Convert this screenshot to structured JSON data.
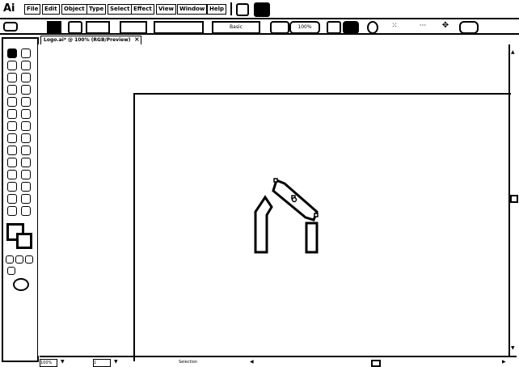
{
  "app": {
    "logo": "Ai"
  },
  "menu": [
    "File",
    "Edit",
    "Object",
    "Type",
    "Select",
    "Effect",
    "View",
    "Window",
    "Help"
  ],
  "control": {
    "opacity": "100%",
    "stroke_style": "Basic"
  },
  "document_tab": {
    "title": "Logo.ai* @ 100% (RGB/Preview)",
    "close": "×"
  },
  "status": {
    "zoom": "100%",
    "tool": "Selection",
    "page": "1"
  }
}
